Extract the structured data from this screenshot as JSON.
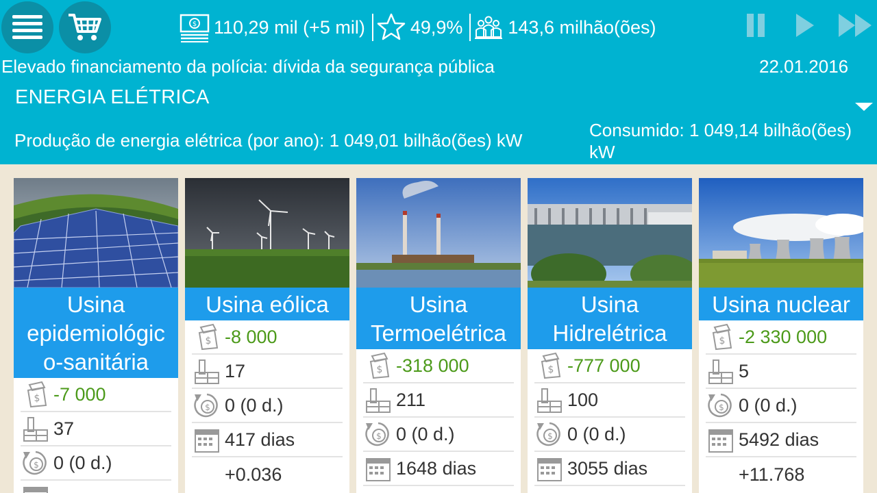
{
  "header": {
    "money": "110,29 mil (+5 mil)",
    "rating": "49,9%",
    "population": "143,6 milhão(ões)",
    "news": "Elevado financiamento da polícia: dívida da segurança pública",
    "date": "22.01.2016",
    "section_title": "ENERGIA ELÉTRICA",
    "production": "Produção de energia elétrica (por ano): 1 049,01 bilhão(ões) kW",
    "consumed": "Consumido: 1 049,14 bilhão(ões) kW"
  },
  "icons": {
    "menu": "menu-icon",
    "cart": "cart-icon",
    "money": "money-icon",
    "rating": "star-icon",
    "population": "people-icon",
    "pause": "pause-icon",
    "play": "play-icon",
    "fast_forward": "fast-forward-icon"
  },
  "colors": {
    "header_bg": "#00b3d1",
    "card_title_bg": "#1e9ceb",
    "positive_value": "#4c9a1a",
    "page_bg": "#efe7d6"
  },
  "cards": [
    {
      "title": "Usina epidemiológic o-sanitária",
      "cost": "-7 000",
      "count": "37",
      "cycle": "0 (0 d.)",
      "days": "",
      "extra": ""
    },
    {
      "title": "Usina eólica",
      "cost": "-8 000",
      "count": "17",
      "cycle": "0 (0 d.)",
      "days": "417 dias",
      "extra": "+0.036"
    },
    {
      "title": "Usina Termoelétrica",
      "cost": "-318 000",
      "count": "211",
      "cycle": "0 (0 d.)",
      "days": "1648 dias",
      "extra": ""
    },
    {
      "title": "Usina Hidrelétrica",
      "cost": "-777 000",
      "count": "100",
      "cycle": "0 (0 d.)",
      "days": "3055 dias",
      "extra": ""
    },
    {
      "title": "Usina nuclear",
      "cost": "-2 330 000",
      "count": "5",
      "cycle": "0 (0 d.)",
      "days": "5492 dias",
      "extra": "+11.768"
    }
  ]
}
